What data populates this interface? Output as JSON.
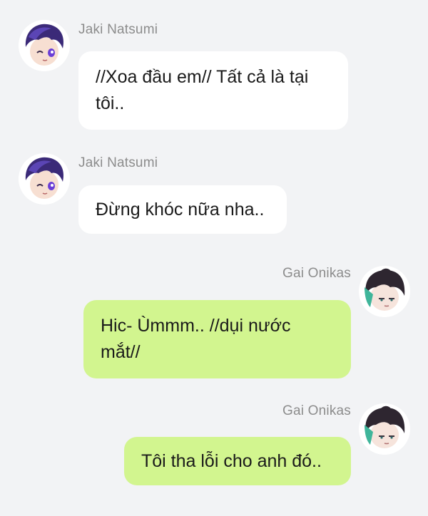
{
  "messages": [
    {
      "sender": "Jaki Natsumi",
      "side": "left",
      "text": "//Xoa đầu em// Tất cả là tại tôi..",
      "avatar": "purple-haired-winking-avatar"
    },
    {
      "sender": "Jaki Natsumi",
      "side": "left",
      "text": "Đừng khóc nữa nha..",
      "avatar": "purple-haired-winking-avatar"
    },
    {
      "sender": "Gai Onikas",
      "side": "right",
      "text": "Hic- Ùmmm.. //dụi nước mắt//",
      "avatar": "dark-haired-teal-accent-avatar"
    },
    {
      "sender": "Gai Onikas",
      "side": "right",
      "text": "Tôi tha lỗi cho anh đó..",
      "avatar": "dark-haired-teal-accent-avatar"
    }
  ],
  "colors": {
    "background": "#f2f3f5",
    "left_bubble": "#ffffff",
    "right_bubble": "#d2f58f",
    "name_text": "#8c8c8c"
  }
}
